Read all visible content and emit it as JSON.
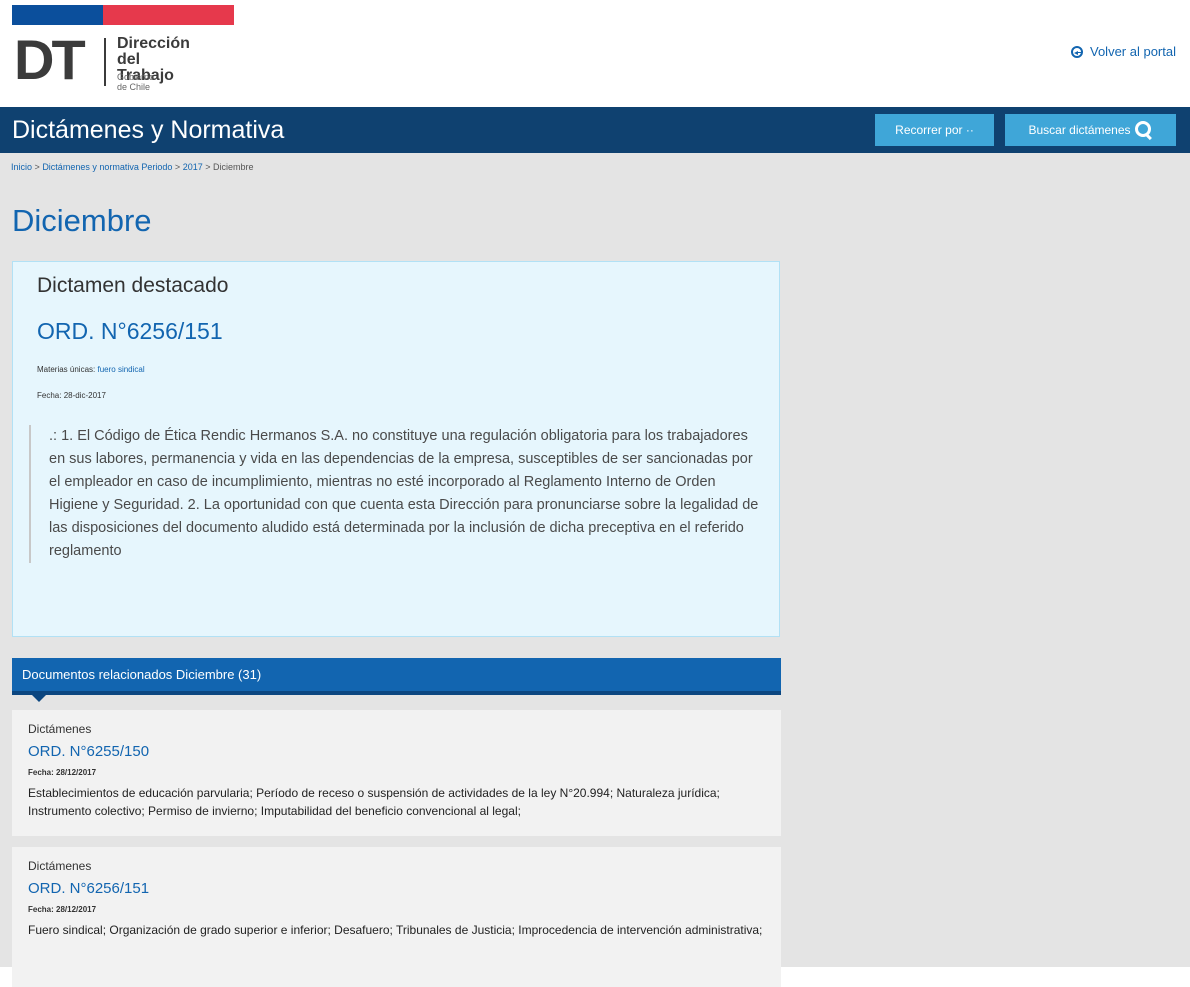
{
  "header": {
    "logo_letters": "DT",
    "logo_line1": "Dirección",
    "logo_line2": "del Trabajo",
    "logo_line3": "Gobierno de Chile",
    "back_link": "Volver al portal"
  },
  "colors": {
    "navy": "#0f4170",
    "primary_blue": "#1265b0",
    "accent_button": "#3fa6d8",
    "brand_blue": "#0b4f9c",
    "brand_red": "#e6394c",
    "featured_bg": "#e6f6fd"
  },
  "navbar": {
    "title": "Dictámenes y Normativa",
    "browse_button": "Recorrer por ··",
    "search_button": "Buscar dictámenes",
    "search_icon": "search-icon"
  },
  "breadcrumb": {
    "home": "Inicio",
    "sep": ">",
    "section": "Dictámenes y normativa",
    "period": "Periodo",
    "year": "2017",
    "current": "Diciembre"
  },
  "page_title": "Diciembre",
  "featured": {
    "heading": "Dictamen destacado",
    "ord": "ORD. N°6256/151",
    "materias_label": "Materias únicas:",
    "materias_value": "fuero sindical",
    "fecha_label": "Fecha:",
    "fecha_value": "28-dic-2017",
    "summary": ".: 1. El Código de Ética Rendic Hermanos S.A. no constituye una regulación obligatoria para los trabajadores en sus labores, permanencia y vida en las dependencias de la empresa, susceptibles de ser sancionadas por el empleador en caso de incumplimiento, mientras no esté incorporado al Reglamento Interno de Orden Higiene y Seguridad. 2. La oportunidad con que cuenta esta Dirección para pronunciarse sobre la legalidad de las disposiciones del documento aludido está determinada por la inclusión de dicha preceptiva en el referido reglamento"
  },
  "related": {
    "header": "Documentos relacionados Diciembre (31)",
    "items": [
      {
        "category": "Dictámenes",
        "ord": "ORD. N°6255/150",
        "fecha_label": "Fecha:",
        "fecha": "28/12/2017",
        "subjects": "Establecimientos de educación parvularia; Período de receso o suspensión de actividades de la ley N°20.994; Naturaleza jurídica; Instrumento colectivo; Permiso de invierno; Imputabilidad del beneficio convencional al legal;"
      },
      {
        "category": "Dictámenes",
        "ord": "ORD. N°6256/151",
        "fecha_label": "Fecha:",
        "fecha": "28/12/2017",
        "subjects": "Fuero sindical; Organización de grado superior e inferior; Desafuero; Tribunales de Justicia; Improcedencia de intervención administrativa;"
      }
    ]
  }
}
